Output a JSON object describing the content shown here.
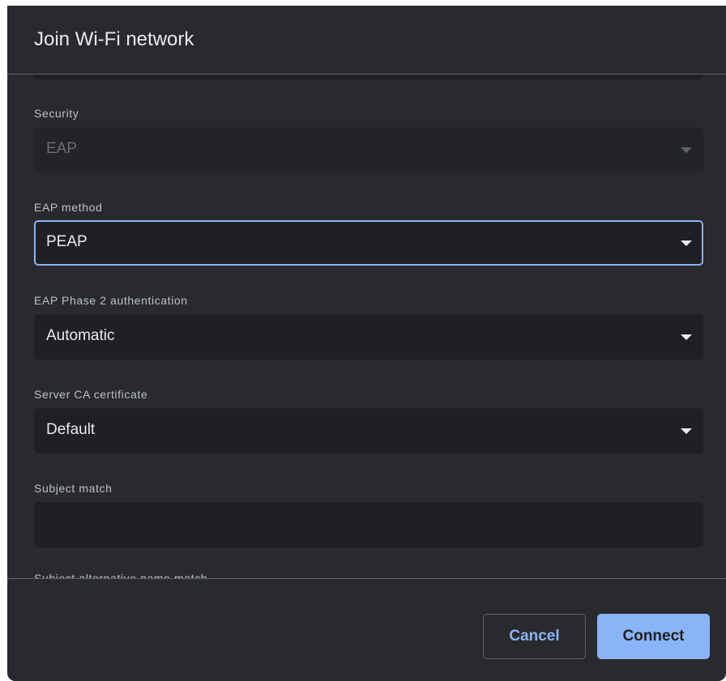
{
  "dialog": {
    "title": "Join Wi-Fi network"
  },
  "fields": {
    "security": {
      "label": "Security",
      "value": "EAP",
      "disabled": true
    },
    "eap_method": {
      "label": "EAP method",
      "value": "PEAP",
      "focused": true
    },
    "eap_phase2": {
      "label": "EAP Phase 2 authentication",
      "value": "Automatic"
    },
    "server_ca": {
      "label": "Server CA certificate",
      "value": "Default"
    },
    "subject_match": {
      "label": "Subject match",
      "value": ""
    },
    "subject_alt_name_match": {
      "label": "Subject alternative name match"
    }
  },
  "buttons": {
    "cancel_label": "Cancel",
    "connect_label": "Connect"
  },
  "icons": {
    "dropdown": "caret-down-icon"
  },
  "colors": {
    "dialog_bg": "#292a2d",
    "field_bg": "#1f2023",
    "accent": "#8ab4f8",
    "text": "#e8eaed",
    "label": "#bdc1c6",
    "divider": "#5f6368"
  }
}
